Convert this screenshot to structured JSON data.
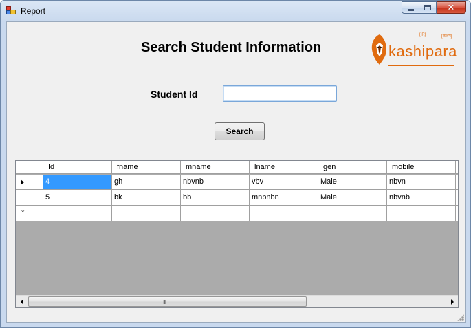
{
  "window": {
    "title": "Report",
    "minimize_icon": "minimize-icon",
    "maximize_icon": "maximize-icon",
    "close_glyph": "✕"
  },
  "form": {
    "heading": "Search Student Information",
    "student_id_label": "Student Id",
    "student_id_value": "",
    "search_label": "Search"
  },
  "logo": {
    "text": "kashipara",
    "small_left": "[IR]",
    "small_right": "[कशप]",
    "accent": "#e06b0f"
  },
  "grid": {
    "columns": [
      "Id",
      "fname",
      "mname",
      "lname",
      "gen",
      "mobile"
    ],
    "rows": [
      {
        "Id": "4",
        "fname": "gh",
        "mname": "nbvnb",
        "lname": "vbv",
        "gen": "Male",
        "mobile": "nbvn"
      },
      {
        "Id": "5",
        "fname": "bk",
        "mname": "bb",
        "lname": "mnbnbn",
        "gen": "Male",
        "mobile": "nbvnb"
      }
    ],
    "new_row_marker": "*",
    "selection_color": "#3399ff",
    "scroll_grip": "III"
  }
}
